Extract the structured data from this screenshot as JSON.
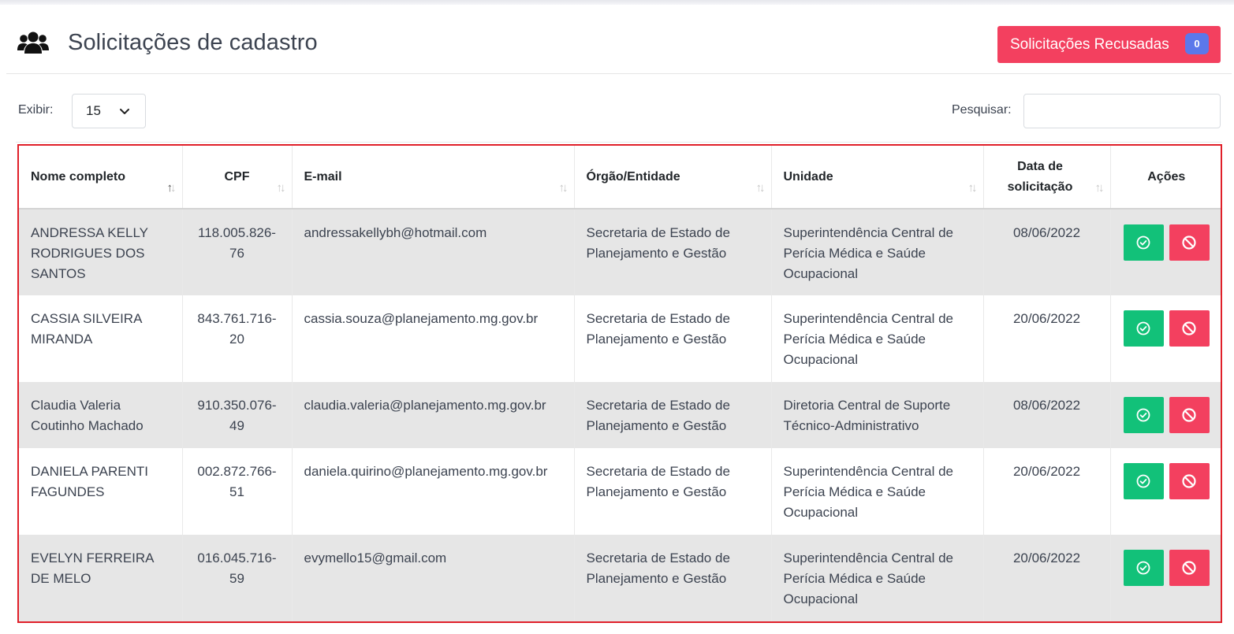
{
  "header": {
    "title": "Solicitações de cadastro",
    "refused_button_label": "Solicitações Recusadas",
    "refused_count": "0"
  },
  "controls": {
    "show_label": "Exibir:",
    "show_value": "15",
    "search_label": "Pesquisar:",
    "search_value": ""
  },
  "table": {
    "columns": [
      {
        "label": "Nome completo"
      },
      {
        "label": "CPF"
      },
      {
        "label": "E-mail"
      },
      {
        "label": "Órgão/Entidade"
      },
      {
        "label": "Unidade"
      },
      {
        "label": "Data de solicitação"
      },
      {
        "label": "Ações"
      }
    ],
    "rows": [
      {
        "name": "ANDRESSA KELLY RODRIGUES DOS SANTOS",
        "cpf": "118.005.826-76",
        "email": "andressakellybh@hotmail.com",
        "orgao": "Secretaria de Estado de Planejamento e Gestão",
        "unidade": "Superintendência Central de Perícia Médica e Saúde Ocupacional",
        "data": "08/06/2022"
      },
      {
        "name": "CASSIA SILVEIRA MIRANDA",
        "cpf": "843.761.716-20",
        "email": "cassia.souza@planejamento.mg.gov.br",
        "orgao": "Secretaria de Estado de Planejamento e Gestão",
        "unidade": "Superintendência Central de Perícia Médica e Saúde Ocupacional",
        "data": "20/06/2022"
      },
      {
        "name": "Claudia Valeria Coutinho Machado",
        "cpf": "910.350.076-49",
        "email": "claudia.valeria@planejamento.mg.gov.br",
        "orgao": "Secretaria de Estado de Planejamento e Gestão",
        "unidade": "Diretoria Central de Suporte Técnico-Administrativo",
        "data": "08/06/2022"
      },
      {
        "name": "DANIELA PARENTI FAGUNDES",
        "cpf": "002.872.766-51",
        "email": "daniela.quirino@planejamento.mg.gov.br",
        "orgao": "Secretaria de Estado de Planejamento e Gestão",
        "unidade": "Superintendência Central de Perícia Médica e Saúde Ocupacional",
        "data": "20/06/2022"
      },
      {
        "name": "EVELYN FERREIRA DE MELO",
        "cpf": "016.045.716-59",
        "email": "evymello15@gmail.com",
        "orgao": "Secretaria de Estado de Planejamento e Gestão",
        "unidade": "Superintendência Central de Perícia Médica e Saúde Ocupacional",
        "data": "20/06/2022"
      }
    ]
  },
  "icons": {
    "title": "users-icon",
    "approve": "check-circle-icon",
    "reject": "ban-icon",
    "select": "chevron-down-icon"
  },
  "colors": {
    "danger": "#f3405f",
    "success": "#12c179",
    "badge": "#5b78ea",
    "highlight_border": "#e01f29"
  }
}
